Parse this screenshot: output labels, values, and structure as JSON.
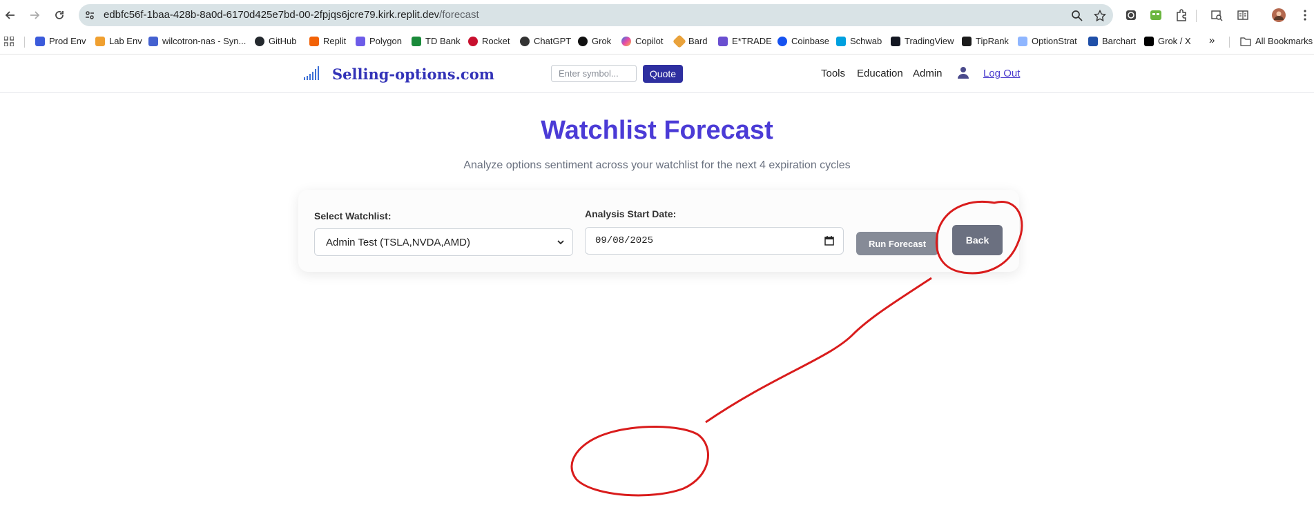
{
  "browser": {
    "url_host": "edbfc56f-1baa-428b-8a0d-6170d425e7bd-00-2fpjqs6jcre79.kirk.replit.dev",
    "url_path": "/forecast",
    "bookmarks": [
      {
        "label": "Prod Env",
        "color": "#3b5bdb"
      },
      {
        "label": "Lab Env",
        "color": "#f0a030"
      },
      {
        "label": "wilcotron-nas - Syn...",
        "color": "#4461d0"
      },
      {
        "label": "GitHub",
        "color": "#24292e"
      },
      {
        "label": "Replit",
        "color": "#f26207"
      },
      {
        "label": "Polygon",
        "color": "#6d5ce8"
      },
      {
        "label": "TD Bank",
        "color": "#1a8a3a"
      },
      {
        "label": "Rocket",
        "color": "#c8102e"
      },
      {
        "label": "ChatGPT",
        "color": "#333333"
      },
      {
        "label": "Grok",
        "color": "#111111"
      },
      {
        "label": "Copilot",
        "color": "#2f7ae5"
      },
      {
        "label": "Bard",
        "color": "#e9a23b"
      },
      {
        "label": "E*TRADE",
        "color": "#6a4fd0"
      },
      {
        "label": "Coinbase",
        "color": "#1652f0"
      },
      {
        "label": "Schwab",
        "color": "#00a0df"
      },
      {
        "label": "TradingView",
        "color": "#131722"
      },
      {
        "label": "TipRank",
        "color": "#1b1b1b"
      },
      {
        "label": "OptionStrat",
        "color": "#8fb6ff"
      },
      {
        "label": "Barchart",
        "color": "#1f4fa8"
      },
      {
        "label": "Grok / X",
        "color": "#000000"
      }
    ],
    "all_bookmarks": "All Bookmarks",
    "overflow": "»"
  },
  "header": {
    "brand": "Selling-options.com",
    "symbol_placeholder": "Enter symbol...",
    "quote_label": "Quote",
    "nav": [
      "Tools",
      "Education",
      "Admin"
    ],
    "logout": "Log Out"
  },
  "main": {
    "title": "Watchlist Forecast",
    "subtitle": "Analyze options sentiment across your watchlist for the next 4 expiration cycles",
    "watchlist_label": "Select Watchlist:",
    "watchlist_value": "Admin Test (TSLA,NVDA,AMD)",
    "date_label": "Analysis Start Date:",
    "date_value": "09/08/2025",
    "run_label": "Run Forecast",
    "back_label": "Back"
  },
  "colors": {
    "brand": "#3333b8",
    "title": "#4b3bd6",
    "quote_button": "#2e2fa0",
    "run_button": "#868b97",
    "back_button": "#6b7080",
    "annotation": "#d91c1c"
  }
}
